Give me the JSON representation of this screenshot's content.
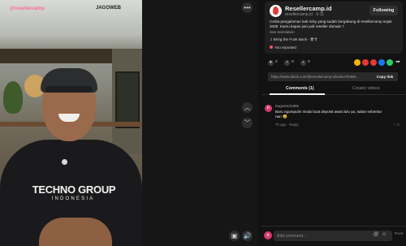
{
  "video": {
    "watermark_left": "@resellercamp",
    "watermark_right": "JAGOWEB",
    "shirt_text": "TECHNO GROUP",
    "shirt_sub": "INDONESIA"
  },
  "controls": {
    "more": "•••",
    "up": "︿",
    "down": "﹀",
    "pip": "▣",
    "volume": "🔊"
  },
  "account": {
    "name": "Resellercamp.id",
    "handle": "resellercamp.id · 6-11",
    "follow_label": "Following"
  },
  "caption": "Cerita pengalaman kak ricky yang sudah bergabung di resellercamp sejak 2009. Kamu kapan join jadi reseller domain ?",
  "see_translation": "See translation",
  "music": "♫  Bring the Funk Back - 卌卄",
  "reposted": "You reposted",
  "stats": {
    "likes": "2",
    "comments": "0",
    "saves": "0"
  },
  "share_colors": [
    "#f5b301",
    "#e53935",
    "#e53935",
    "#1877f2",
    "#25d366"
  ],
  "share_more": "➦",
  "url": "https://www.tiktok.com/@resellercamp.id/video/76499...",
  "copy_link": "Copy link",
  "tabs": {
    "comments": "Comments (1)",
    "creator": "Creator videos"
  },
  "comment": {
    "avatar_letter": "b",
    "user": "bagusmd1965",
    "text": "Baru ngumpulin moda buat deposit awal dulu ya, sabar sebentar nan 😄",
    "meta": "7h ago · Reply",
    "likes": "♡ 0"
  },
  "composer": {
    "avatar_letter": "b",
    "placeholder": "Add comment...",
    "at": "@",
    "emoji": "☺",
    "post": "Post"
  }
}
